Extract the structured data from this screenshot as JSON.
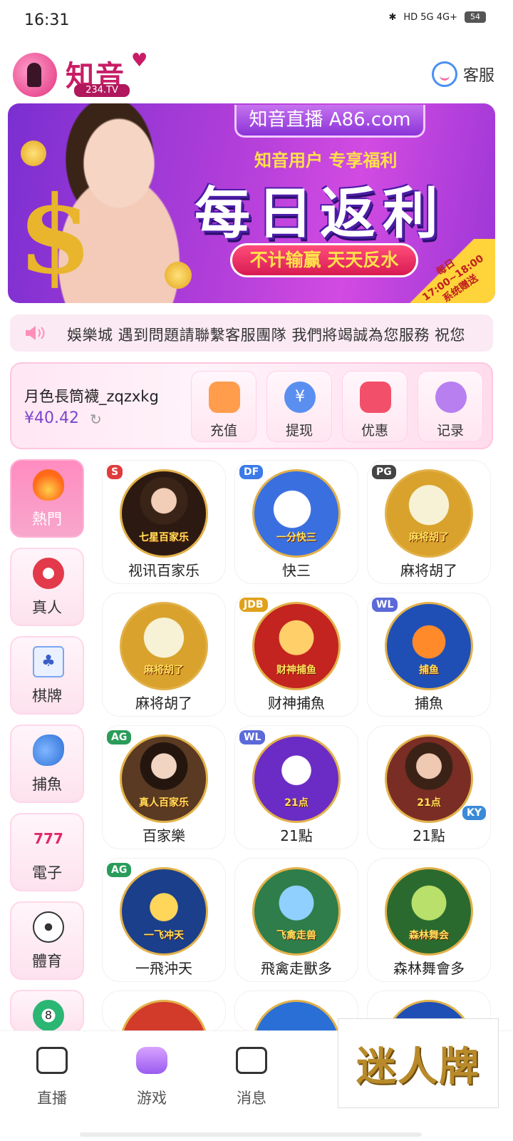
{
  "status_bar": {
    "time": "16:31",
    "network": "HD 5G 4G+",
    "battery": "54"
  },
  "header": {
    "logo_text": "知音",
    "logo_sub": "234.TV",
    "support_label": "客服"
  },
  "banner": {
    "site": "知音直播 A86.com",
    "subtitle": "知音用户 专享福利",
    "title": "每日返利",
    "pill": "不计输赢 天天反水",
    "corner": "每日17:00~18:00 系统赠送"
  },
  "marquee": {
    "text": "娛樂城 遇到問題請聯繫客服團隊 我們將竭誠為您服務 祝您"
  },
  "wallet": {
    "username": "月色長筒襪_zqzxkg",
    "balance": "¥40.42",
    "actions": [
      {
        "label": "充值",
        "color": "#ff9d4d"
      },
      {
        "label": "提现",
        "color": "#5a8ff0"
      },
      {
        "label": "优惠",
        "color": "#f2506a"
      },
      {
        "label": "记录",
        "color": "#b77ff0"
      }
    ]
  },
  "categories": [
    {
      "label": "熱門",
      "active": true
    },
    {
      "label": "真人"
    },
    {
      "label": "棋牌"
    },
    {
      "label": "捕魚"
    },
    {
      "label": "電子"
    },
    {
      "label": "體育"
    }
  ],
  "games": [
    {
      "label": "视讯百家乐",
      "badge": "S",
      "art_text": "七星百家乐"
    },
    {
      "label": "快三",
      "badge": "DF",
      "art_text": "一分快三"
    },
    {
      "label": "麻将胡了",
      "badge": "PG",
      "art_text": "麻将胡了"
    },
    {
      "label": "麻将胡了",
      "badge": "",
      "art_text": "麻将胡了"
    },
    {
      "label": "财神捕魚",
      "badge": "JDB",
      "art_text": "财神捕鱼"
    },
    {
      "label": "捕魚",
      "badge": "WL",
      "art_text": "捕鱼"
    },
    {
      "label": "百家樂",
      "badge": "AG",
      "art_text": "真人百家乐"
    },
    {
      "label": "21點",
      "badge": "WL",
      "art_text": "21点"
    },
    {
      "label": "21點",
      "badge": "KY",
      "art_text": "21点"
    },
    {
      "label": "一飛沖天",
      "badge": "AG",
      "art_text": "一飞冲天"
    },
    {
      "label": "飛禽走獸多",
      "badge": "",
      "art_text": "飞禽走兽"
    },
    {
      "label": "森林舞會多",
      "badge": "",
      "art_text": "森林舞会"
    }
  ],
  "bottom_nav": [
    {
      "label": "直播"
    },
    {
      "label": "游戏"
    },
    {
      "label": "消息"
    }
  ],
  "watermark": "迷人牌"
}
